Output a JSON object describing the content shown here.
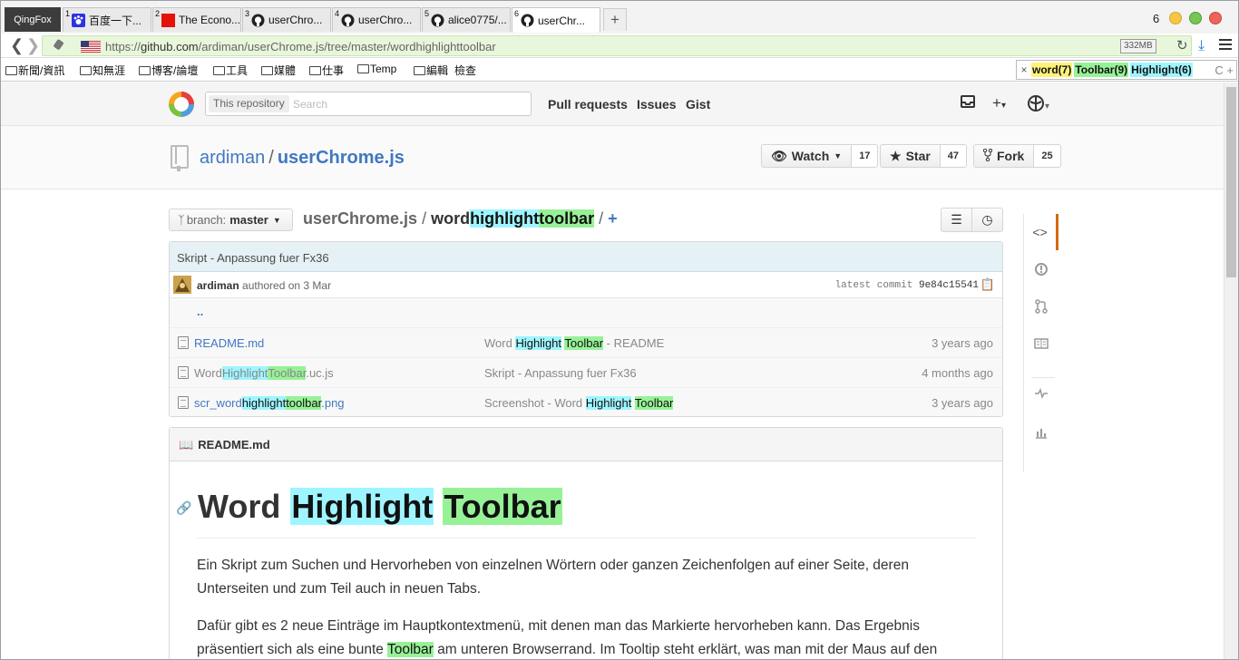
{
  "browser": {
    "app_button": "QingFox",
    "tabs": [
      {
        "num": "1",
        "title": "百度一下..."
      },
      {
        "num": "2",
        "title": "The Econo..."
      },
      {
        "num": "3",
        "title": "userChro..."
      },
      {
        "num": "4",
        "title": "userChro..."
      },
      {
        "num": "5",
        "title": "alice0775/..."
      },
      {
        "num": "6",
        "title": "userChr..."
      }
    ],
    "new_tab": "+",
    "tab_count": "6",
    "url_prefix": "https://",
    "url_domain": "github.com",
    "url_path": "/ardiman/userChrome.js/tree/master/wordhighlighttoolbar",
    "memory": "332MB",
    "bookmarks": [
      "新聞/資訊",
      "知無涯",
      "博客/論壇",
      "工具",
      "媒體",
      "仕事",
      "Temp",
      "編輯",
      "檢查"
    ],
    "highlight_bar": {
      "close": "×",
      "chips": [
        {
          "label": "word(7)",
          "color": "yellow"
        },
        {
          "label": "Toolbar(9)",
          "color": "green"
        },
        {
          "label": "Highlight(6)",
          "color": "cyan"
        }
      ],
      "tail": "C +"
    }
  },
  "github": {
    "search_scope": "This repository",
    "search_placeholder": "Search",
    "nav": [
      "Pull requests",
      "Issues",
      "Gist"
    ],
    "owner": "ardiman",
    "separator": "/",
    "repo": "userChrome.js",
    "watch_label": "Watch",
    "watch_count": "17",
    "star_label": "Star",
    "star_count": "47",
    "fork_label": "Fork",
    "fork_count": "25",
    "branch_prefix": "branch:",
    "branch_name": "master",
    "breadcrumb_repo": "userChrome.js",
    "breadcrumb_sep": "/",
    "breadcrumb_parts": [
      "word",
      "highlight",
      "toolbar"
    ],
    "breadcrumb_tail": "/",
    "breadcrumb_add": "+",
    "commit_message": "Skript - Anpassung fuer Fx36",
    "commit_author": "ardiman",
    "commit_when": "authored on 3 Mar",
    "latest_commit_label": "latest commit",
    "latest_commit_sha": "9e84c15541",
    "parent_dir": "..",
    "files": [
      {
        "name_parts": [
          "README.md"
        ],
        "msg_parts": [
          "Word ",
          "Highlight",
          " ",
          "Toolbar",
          " - README"
        ],
        "age": "3 years ago"
      },
      {
        "name_parts": [
          "Word",
          "Highlight",
          "Toolbar",
          ".uc.js"
        ],
        "msg_parts": [
          "Skript - Anpassung fuer Fx36"
        ],
        "age": "4 months ago"
      },
      {
        "name_parts": [
          "scr_word",
          "highlight",
          "toolbar",
          ".png"
        ],
        "msg_parts": [
          "Screenshot - Word ",
          "Highlight",
          " ",
          "Toolbar"
        ],
        "age": "3 years ago"
      }
    ],
    "readme_label": "README.md",
    "readme_title_parts": [
      "Word",
      "Highlight",
      "Toolbar"
    ],
    "readme_p1": "Ein Skript zum Suchen und Hervorheben von einzelnen Wörtern oder ganzen Zeichenfolgen auf einer Seite, deren Unterseiten und zum Teil auch in neuen Tabs.",
    "readme_p2_a": "Dafür gibt es 2 neue Einträge im Hauptkontextmenü, mit denen man das Markierte hervorheben kann. Das Ergebnis präsentiert sich als eine bunte ",
    "readme_p2_b": "Toolbar",
    "readme_p2_c": " am unteren Browserrand. Im Tooltip steht erklärt, was man mit der Maus auf den"
  },
  "colors": {
    "highlight_cyan": "#9ff5ff",
    "highlight_green": "#97f297",
    "highlight_yellow": "#fff27a",
    "link_blue": "#4078c0",
    "url_bar_green": "#e8f7dc"
  }
}
